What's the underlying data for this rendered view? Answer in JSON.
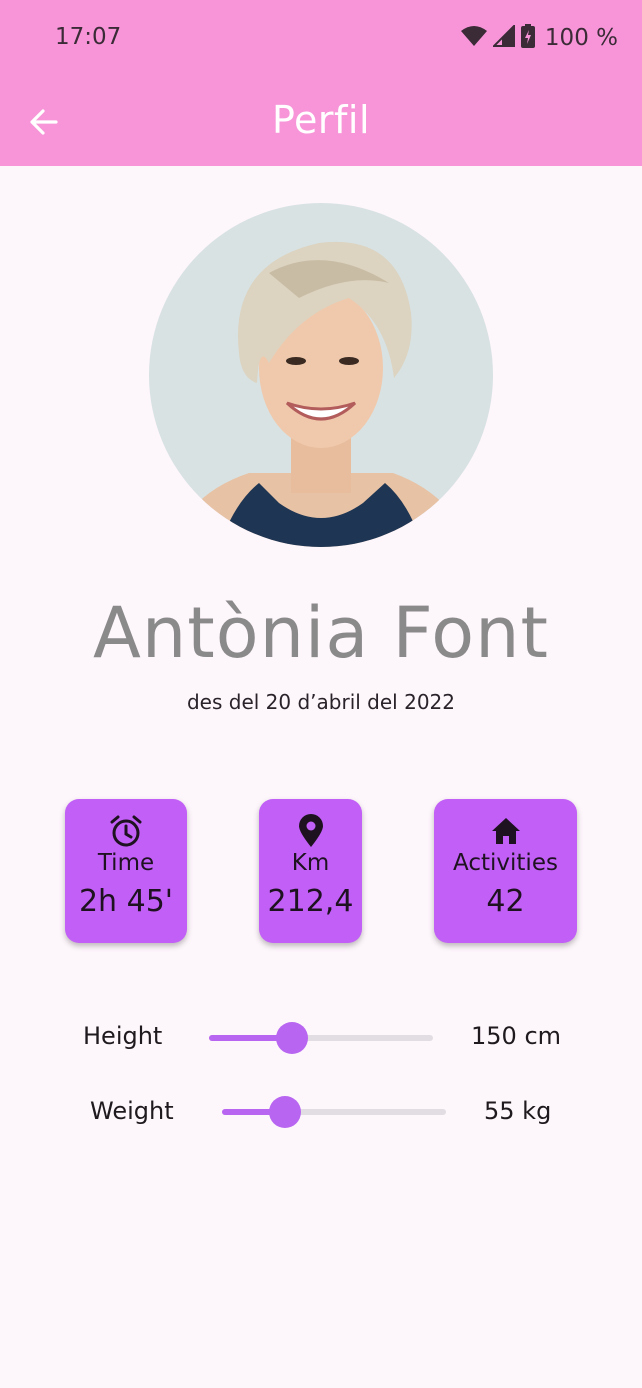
{
  "status_bar": {
    "time": "17:07",
    "battery": "100 %",
    "icons": [
      "wifi-icon",
      "signal-icon",
      "battery-charging-icon"
    ]
  },
  "app_bar": {
    "title": "Perfil",
    "back_icon": "arrow-back-icon"
  },
  "profile": {
    "name": "Antònia Font",
    "member_since": "des del 20 d’abril del 2022"
  },
  "stats": [
    {
      "icon": "alarm-clock-icon",
      "label": "Time",
      "value": "2h 45'"
    },
    {
      "icon": "location-pin-icon",
      "label": "Km",
      "value": "212,4"
    },
    {
      "icon": "home-icon",
      "label": "Activities",
      "value": "42"
    }
  ],
  "sliders": {
    "height": {
      "label": "Height",
      "value": "150 cm",
      "fraction": 0.37
    },
    "weight": {
      "label": "Weight",
      "value": "55 kg",
      "fraction": 0.28
    }
  },
  "colors": {
    "app_bar": "#f795d8",
    "accent": "#c15ff7",
    "slider": "#b865f1",
    "background": "#fdf6fb"
  }
}
